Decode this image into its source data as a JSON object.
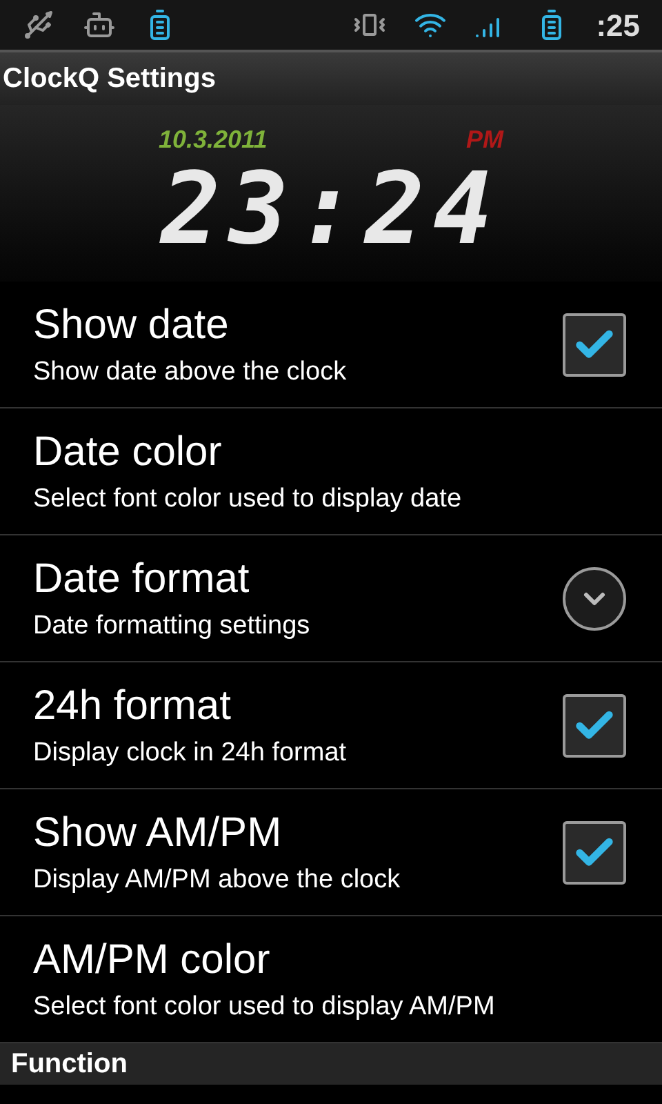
{
  "status_bar": {
    "time": ":25"
  },
  "title": "ClockQ Settings",
  "clock": {
    "date": "10.3.2011",
    "ampm": "PM",
    "time": "23:24"
  },
  "settings": [
    {
      "kind": "checkbox",
      "title": "Show date",
      "summary": "Show date above the clock",
      "checked": true
    },
    {
      "kind": "plain",
      "title": "Date color",
      "summary": "Select font color used to display date"
    },
    {
      "kind": "dropdown",
      "title": "Date format",
      "summary": "Date formatting settings"
    },
    {
      "kind": "checkbox",
      "title": "24h format",
      "summary": "Display clock in 24h format",
      "checked": true
    },
    {
      "kind": "checkbox",
      "title": "Show AM/PM",
      "summary": "Display AM/PM above the clock",
      "checked": true
    },
    {
      "kind": "plain",
      "title": "AM/PM color",
      "summary": "Select font color used to display AM/PM"
    }
  ],
  "category": "Function"
}
